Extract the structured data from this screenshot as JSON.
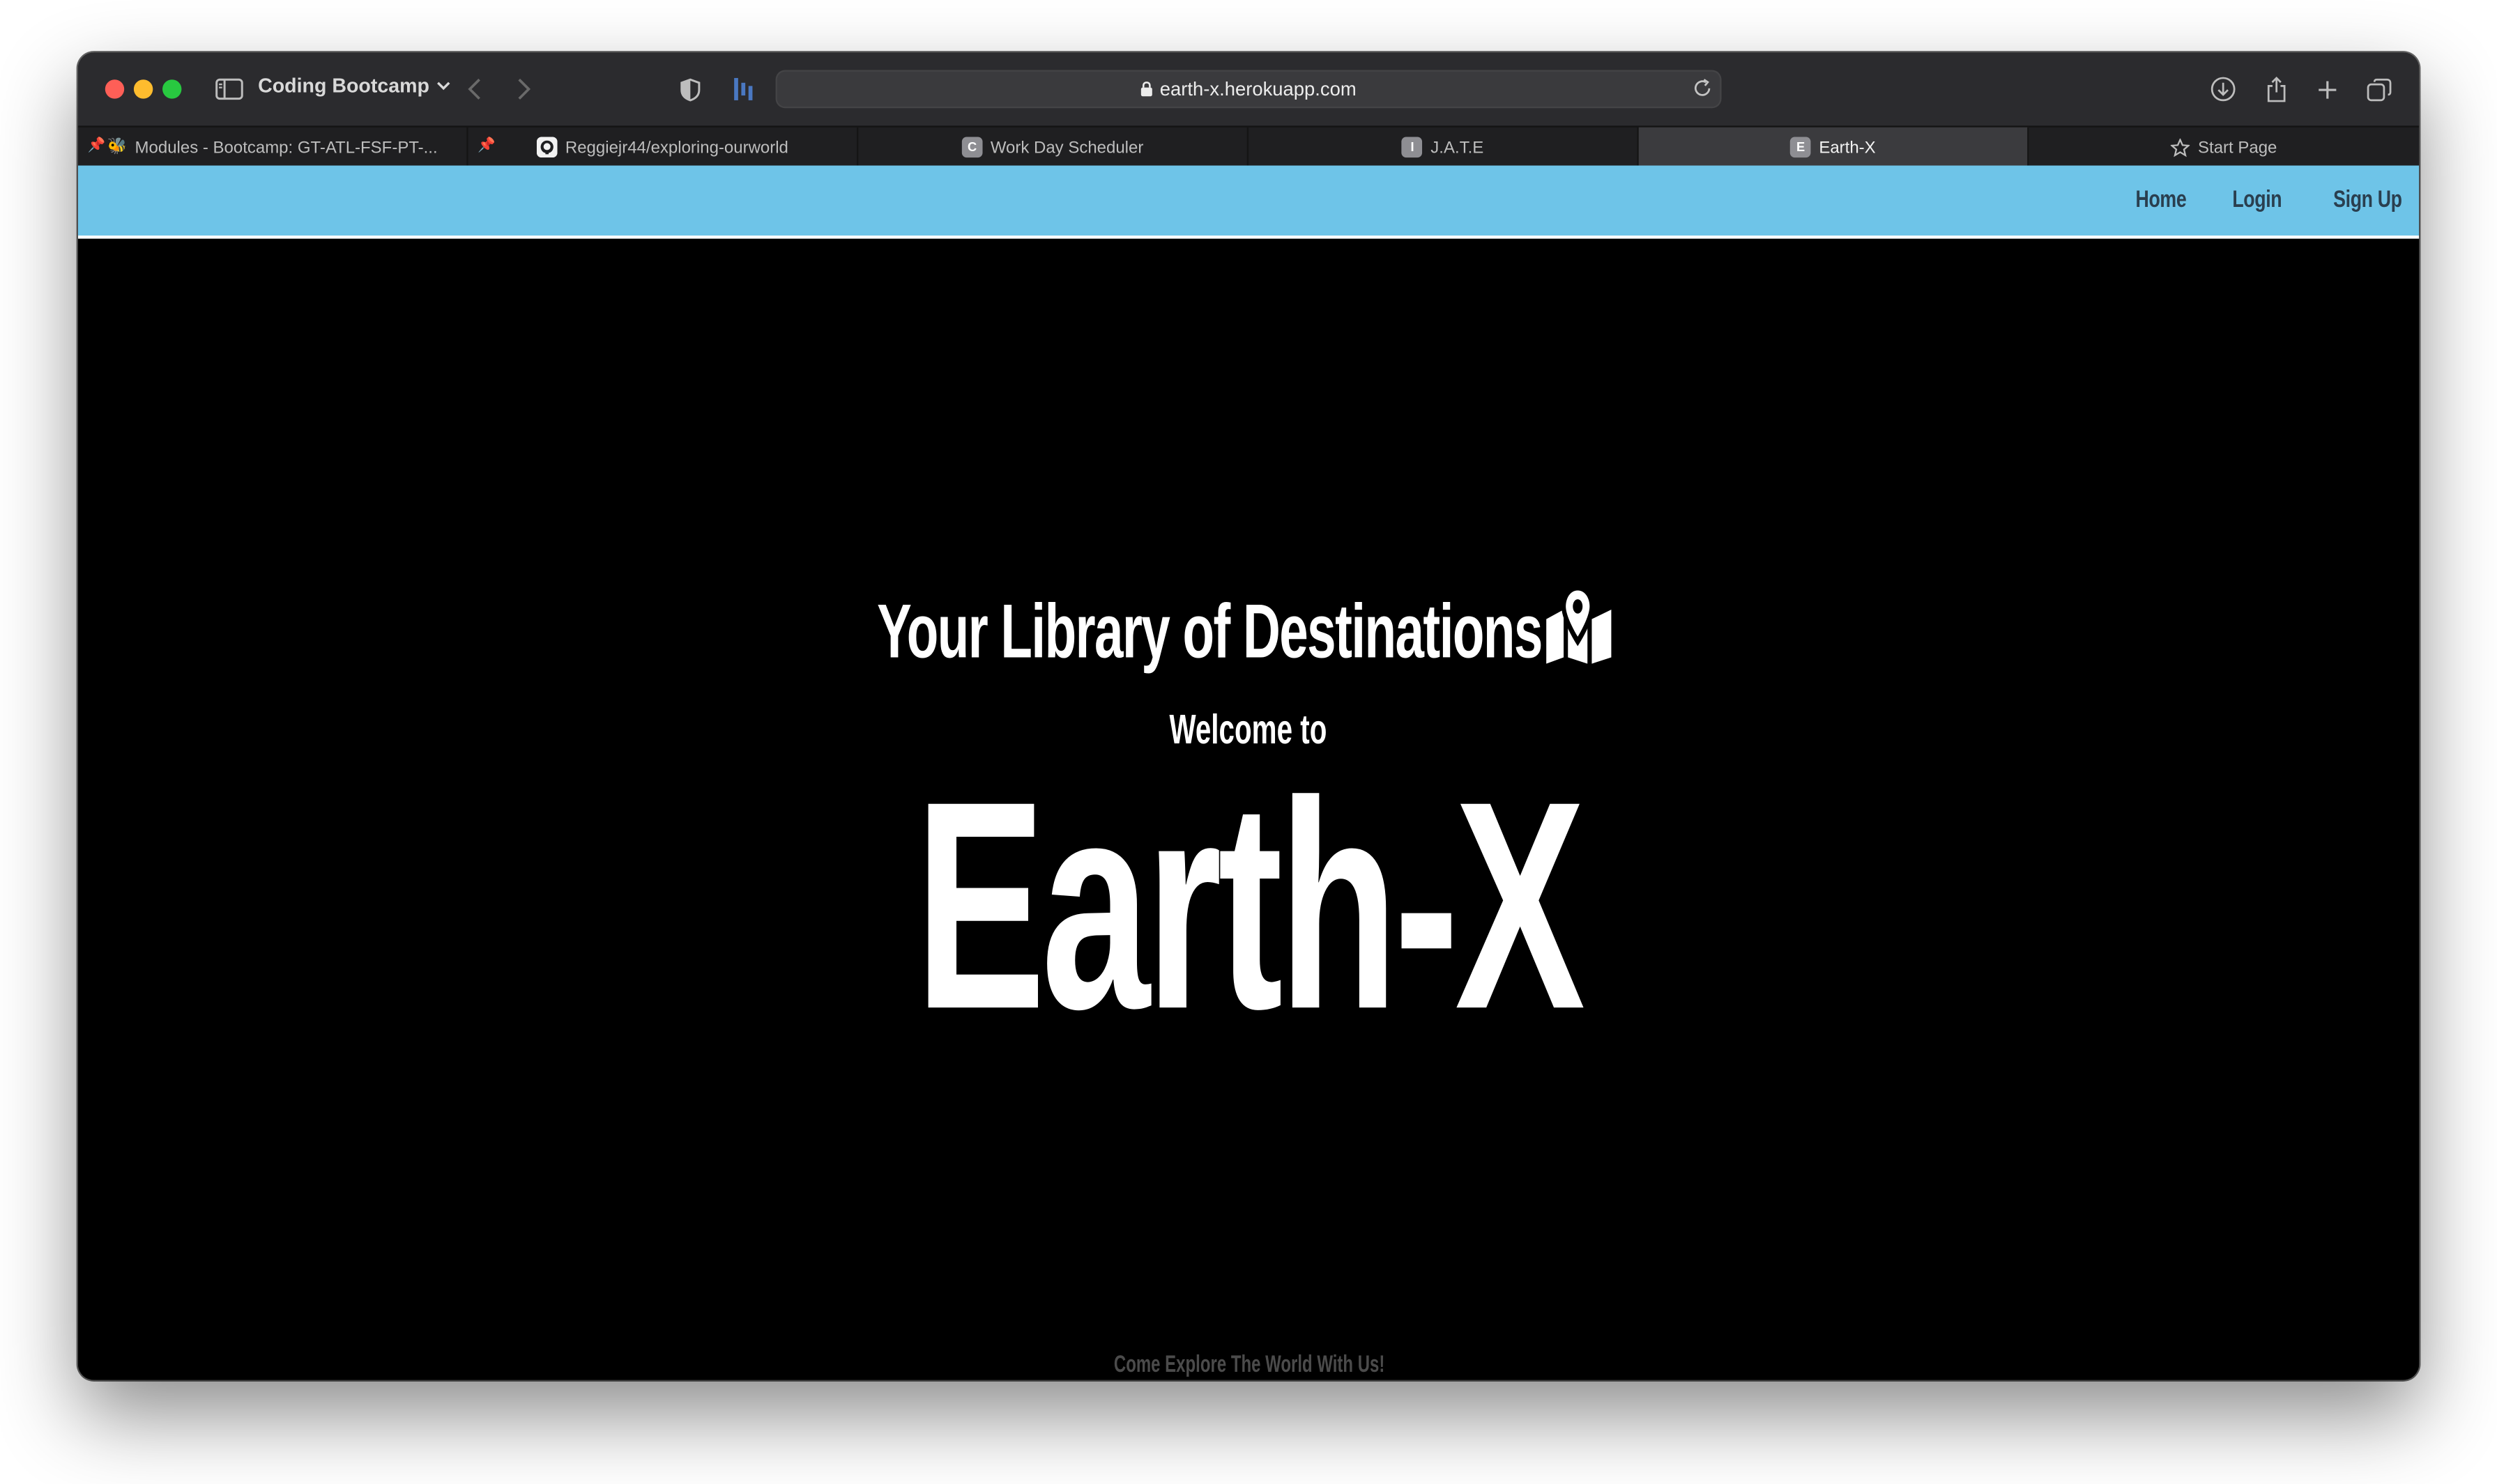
{
  "browser": {
    "tab_group": "Coding Bootcamp",
    "url": "earth-x.herokuapp.com",
    "tabs": [
      {
        "label": "Modules - Bootcamp: GT-ATL-FSF-PT-...",
        "favicon": "",
        "pinned": true
      },
      {
        "label": "Reggiejr44/exploring-ourworld",
        "favicon": "github-icon",
        "pinned": true
      },
      {
        "label": "Work Day Scheduler",
        "favicon": "C",
        "pinned": false
      },
      {
        "label": "J.A.T.E",
        "favicon": "I",
        "pinned": false
      },
      {
        "label": "Earth-X",
        "favicon": "E",
        "pinned": false,
        "active": true
      },
      {
        "label": "Start Page",
        "favicon": "star-icon",
        "pinned": false
      }
    ]
  },
  "navbar": {
    "links": [
      "Home",
      "Login",
      "Sign Up"
    ],
    "background": "#6ec4e8"
  },
  "hero": {
    "headline": "Your Library of Destinations",
    "welcome": "Welcome to",
    "brand": "Earth-X",
    "footer": "Come Explore The World With Us!"
  },
  "colors": {
    "page_background": "#000000",
    "text": "#ffffff",
    "footer_text": "#4b4b4b"
  }
}
